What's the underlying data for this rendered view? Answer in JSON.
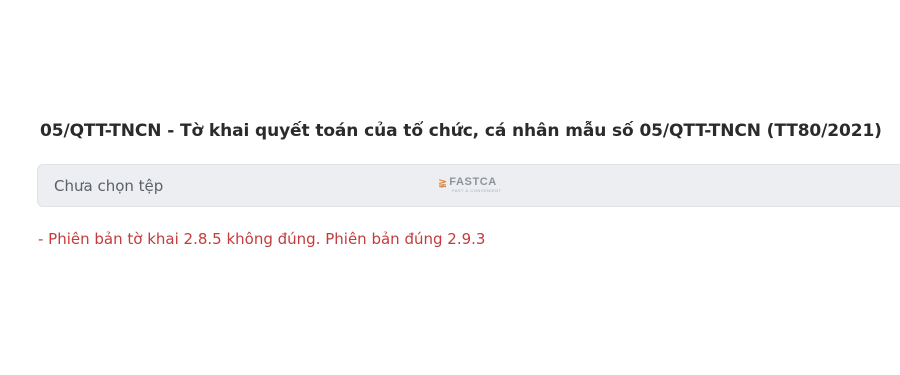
{
  "form": {
    "title": "05/QTT-TNCN - Tờ khai quyết toán của tổ chức, cá nhân mẫu số 05/QTT-TNCN (TT80/2021)"
  },
  "file_input": {
    "placeholder": "Chưa chọn tệp"
  },
  "watermark": {
    "brand": "FASTCA",
    "tagline": "FAST & CONVENIENT"
  },
  "validation": {
    "error": "- Phiên bản tờ khai 2.8.5 không đúng. Phiên bản đúng 2.9.3"
  },
  "colors": {
    "error": "#c43b3b",
    "file_box_bg": "#eceef1",
    "title": "#2b2b2b"
  }
}
